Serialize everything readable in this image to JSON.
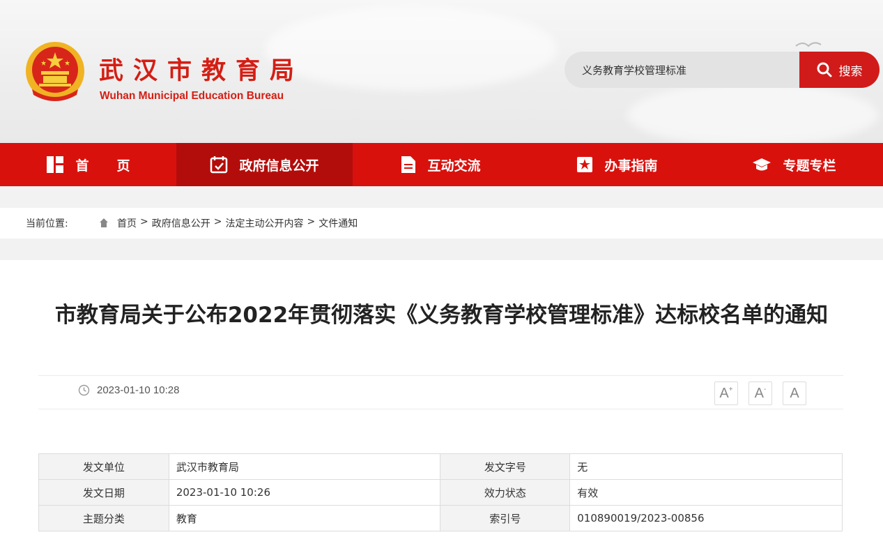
{
  "header": {
    "logo_cn": "武汉市教育局",
    "logo_en": "Wuhan Municipal Education Bureau",
    "search": {
      "value": "义务教育学校管理标准",
      "button_label": "搜索",
      "icon": "search-icon"
    }
  },
  "nav": {
    "items": [
      {
        "label": "首页",
        "icon": "dashboard-icon",
        "active": false
      },
      {
        "label": "政府信息公开",
        "icon": "calendar-check-icon",
        "active": true
      },
      {
        "label": "互动交流",
        "icon": "document-icon",
        "active": false
      },
      {
        "label": "办事指南",
        "icon": "bookmark-star-icon",
        "active": false
      },
      {
        "label": "专题专栏",
        "icon": "graduation-cap-icon",
        "active": false
      }
    ]
  },
  "breadcrumb": {
    "label": "当前位置:",
    "items": [
      "首页",
      "政府信息公开",
      "法定主动公开内容",
      "文件通知"
    ],
    "separator": ">"
  },
  "article": {
    "title": "市教育局关于公布2022年贯彻落实《义务教育学校管理标准》达标校名单的通知",
    "publish_time": "2023-01-10 10:28",
    "font_controls": {
      "increase": "A",
      "decrease": "A",
      "reset": "A"
    },
    "info": [
      {
        "k1": "发文单位",
        "v1": "武汉市教育局",
        "k2": "发文字号",
        "v2": "无"
      },
      {
        "k1": "发文日期",
        "v1": "2023-01-10 10:26",
        "k2": "效力状态",
        "v2": "有效"
      },
      {
        "k1": "主题分类",
        "v1": "教育",
        "k2": "索引号",
        "v2": "010890019/2023-00856"
      }
    ]
  },
  "colors": {
    "brand_red": "#d9110d",
    "nav_active": "#b30d0b",
    "logo_red": "#d41e14"
  }
}
